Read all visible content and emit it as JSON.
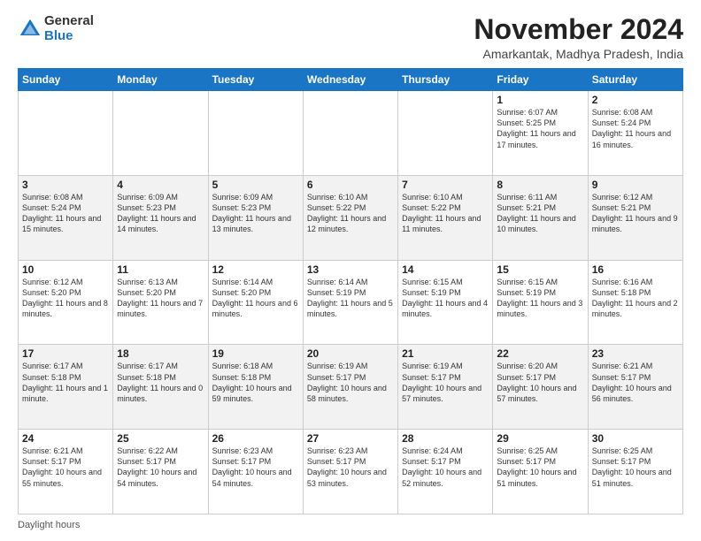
{
  "header": {
    "logo_general": "General",
    "logo_blue": "Blue",
    "month_title": "November 2024",
    "location": "Amarkantak, Madhya Pradesh, India"
  },
  "days_of_week": [
    "Sunday",
    "Monday",
    "Tuesday",
    "Wednesday",
    "Thursday",
    "Friday",
    "Saturday"
  ],
  "weeks": [
    [
      {
        "day": "",
        "info": ""
      },
      {
        "day": "",
        "info": ""
      },
      {
        "day": "",
        "info": ""
      },
      {
        "day": "",
        "info": ""
      },
      {
        "day": "",
        "info": ""
      },
      {
        "day": "1",
        "info": "Sunrise: 6:07 AM\nSunset: 5:25 PM\nDaylight: 11 hours and 17 minutes."
      },
      {
        "day": "2",
        "info": "Sunrise: 6:08 AM\nSunset: 5:24 PM\nDaylight: 11 hours and 16 minutes."
      }
    ],
    [
      {
        "day": "3",
        "info": "Sunrise: 6:08 AM\nSunset: 5:24 PM\nDaylight: 11 hours and 15 minutes."
      },
      {
        "day": "4",
        "info": "Sunrise: 6:09 AM\nSunset: 5:23 PM\nDaylight: 11 hours and 14 minutes."
      },
      {
        "day": "5",
        "info": "Sunrise: 6:09 AM\nSunset: 5:23 PM\nDaylight: 11 hours and 13 minutes."
      },
      {
        "day": "6",
        "info": "Sunrise: 6:10 AM\nSunset: 5:22 PM\nDaylight: 11 hours and 12 minutes."
      },
      {
        "day": "7",
        "info": "Sunrise: 6:10 AM\nSunset: 5:22 PM\nDaylight: 11 hours and 11 minutes."
      },
      {
        "day": "8",
        "info": "Sunrise: 6:11 AM\nSunset: 5:21 PM\nDaylight: 11 hours and 10 minutes."
      },
      {
        "day": "9",
        "info": "Sunrise: 6:12 AM\nSunset: 5:21 PM\nDaylight: 11 hours and 9 minutes."
      }
    ],
    [
      {
        "day": "10",
        "info": "Sunrise: 6:12 AM\nSunset: 5:20 PM\nDaylight: 11 hours and 8 minutes."
      },
      {
        "day": "11",
        "info": "Sunrise: 6:13 AM\nSunset: 5:20 PM\nDaylight: 11 hours and 7 minutes."
      },
      {
        "day": "12",
        "info": "Sunrise: 6:14 AM\nSunset: 5:20 PM\nDaylight: 11 hours and 6 minutes."
      },
      {
        "day": "13",
        "info": "Sunrise: 6:14 AM\nSunset: 5:19 PM\nDaylight: 11 hours and 5 minutes."
      },
      {
        "day": "14",
        "info": "Sunrise: 6:15 AM\nSunset: 5:19 PM\nDaylight: 11 hours and 4 minutes."
      },
      {
        "day": "15",
        "info": "Sunrise: 6:15 AM\nSunset: 5:19 PM\nDaylight: 11 hours and 3 minutes."
      },
      {
        "day": "16",
        "info": "Sunrise: 6:16 AM\nSunset: 5:18 PM\nDaylight: 11 hours and 2 minutes."
      }
    ],
    [
      {
        "day": "17",
        "info": "Sunrise: 6:17 AM\nSunset: 5:18 PM\nDaylight: 11 hours and 1 minute."
      },
      {
        "day": "18",
        "info": "Sunrise: 6:17 AM\nSunset: 5:18 PM\nDaylight: 11 hours and 0 minutes."
      },
      {
        "day": "19",
        "info": "Sunrise: 6:18 AM\nSunset: 5:18 PM\nDaylight: 10 hours and 59 minutes."
      },
      {
        "day": "20",
        "info": "Sunrise: 6:19 AM\nSunset: 5:17 PM\nDaylight: 10 hours and 58 minutes."
      },
      {
        "day": "21",
        "info": "Sunrise: 6:19 AM\nSunset: 5:17 PM\nDaylight: 10 hours and 57 minutes."
      },
      {
        "day": "22",
        "info": "Sunrise: 6:20 AM\nSunset: 5:17 PM\nDaylight: 10 hours and 57 minutes."
      },
      {
        "day": "23",
        "info": "Sunrise: 6:21 AM\nSunset: 5:17 PM\nDaylight: 10 hours and 56 minutes."
      }
    ],
    [
      {
        "day": "24",
        "info": "Sunrise: 6:21 AM\nSunset: 5:17 PM\nDaylight: 10 hours and 55 minutes."
      },
      {
        "day": "25",
        "info": "Sunrise: 6:22 AM\nSunset: 5:17 PM\nDaylight: 10 hours and 54 minutes."
      },
      {
        "day": "26",
        "info": "Sunrise: 6:23 AM\nSunset: 5:17 PM\nDaylight: 10 hours and 54 minutes."
      },
      {
        "day": "27",
        "info": "Sunrise: 6:23 AM\nSunset: 5:17 PM\nDaylight: 10 hours and 53 minutes."
      },
      {
        "day": "28",
        "info": "Sunrise: 6:24 AM\nSunset: 5:17 PM\nDaylight: 10 hours and 52 minutes."
      },
      {
        "day": "29",
        "info": "Sunrise: 6:25 AM\nSunset: 5:17 PM\nDaylight: 10 hours and 51 minutes."
      },
      {
        "day": "30",
        "info": "Sunrise: 6:25 AM\nSunset: 5:17 PM\nDaylight: 10 hours and 51 minutes."
      }
    ]
  ],
  "footer": {
    "daylight_label": "Daylight hours"
  }
}
